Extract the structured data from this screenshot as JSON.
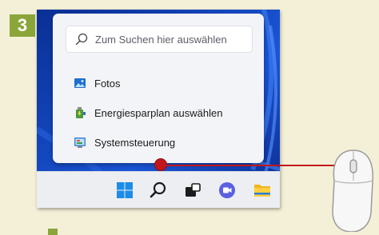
{
  "step": {
    "number": "3"
  },
  "search": {
    "placeholder": "Zum Suchen hier auswählen"
  },
  "menu": {
    "items": [
      {
        "label": "Fotos",
        "icon": "photos-icon"
      },
      {
        "label": "Energiesparplan auswählen",
        "icon": "power-plan-icon"
      },
      {
        "label": "Systemsteuerung",
        "icon": "control-panel-icon"
      }
    ]
  },
  "taskbar": {
    "icons": [
      "windows-start-icon",
      "search-icon",
      "task-view-icon",
      "chat-icon",
      "file-explorer-icon"
    ]
  },
  "colors": {
    "accent_green": "#8aa63a",
    "pointer_red": "#c0161c",
    "page_background": "#f4f0d8",
    "wallpaper_blue": "#0e3da8"
  }
}
